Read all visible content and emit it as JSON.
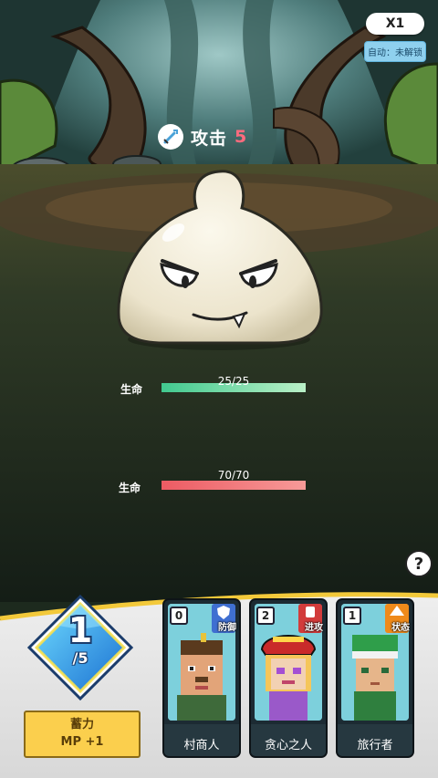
{
  "hud": {
    "speed_label": "X1",
    "auto_label": "自动：未解锁",
    "help_label": "?"
  },
  "enemy": {
    "attack_label": "攻击",
    "attack_value": "5",
    "hp_label": "生命",
    "hp_text": "25/25",
    "hp_current": 25,
    "hp_max": 25
  },
  "player": {
    "hp_label": "生命",
    "hp_text": "70/70",
    "hp_current": 70,
    "hp_max": 70
  },
  "mana": {
    "current": "1",
    "max_text": "/5"
  },
  "charge_button": {
    "line1": "蓄力",
    "line2": "MP +1"
  },
  "cards": [
    {
      "cost": "0",
      "tag": "防御",
      "name": "村商人",
      "tag_color": "#3f6fd1"
    },
    {
      "cost": "2",
      "tag": "进攻",
      "name": "贪心之人",
      "tag_color": "#d23b3b"
    },
    {
      "cost": "1",
      "tag": "状态",
      "name": "旅行者",
      "tag_color": "#ef8a1a"
    }
  ],
  "colors": {
    "enemy_hp": "#67e0a8",
    "player_hp": "#f07070",
    "panel_border": "#f3c93a",
    "mana_gem": "#3aa3e8"
  }
}
